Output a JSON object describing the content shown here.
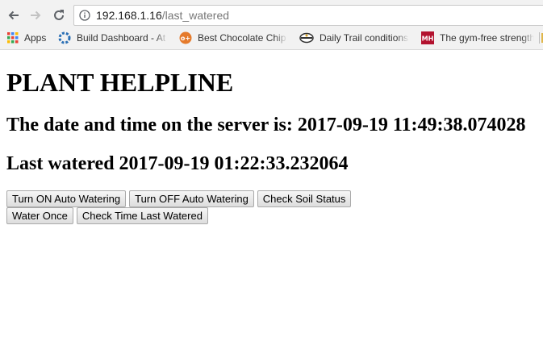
{
  "browser": {
    "url_host": "192.168.1.16",
    "url_path": "/last_watered",
    "bookmarks": [
      {
        "label": "Apps",
        "icon": "apps-grid-icon"
      },
      {
        "label": "Build Dashboard - At",
        "icon": "build-dashboard-icon"
      },
      {
        "label": "Best Chocolate Chip C",
        "icon": "chocolate-chip-site-icon"
      },
      {
        "label": "Daily Trail conditions",
        "icon": "trail-conditions-icon"
      },
      {
        "label": "The gym-free strength",
        "icon": "mh-logo-icon"
      }
    ]
  },
  "page": {
    "title": "PLANT HELPLINE",
    "server_time": "The date and time on the server is: 2017-09-19 11:49:38.074028",
    "last_watered": "Last watered 2017-09-19 01:22:33.232064",
    "buttons": {
      "auto_on": "Turn ON Auto Watering",
      "auto_off": "Turn OFF Auto Watering",
      "soil_status": "Check Soil Status",
      "water_once": "Water Once",
      "check_time": "Check Time Last Watered"
    }
  }
}
